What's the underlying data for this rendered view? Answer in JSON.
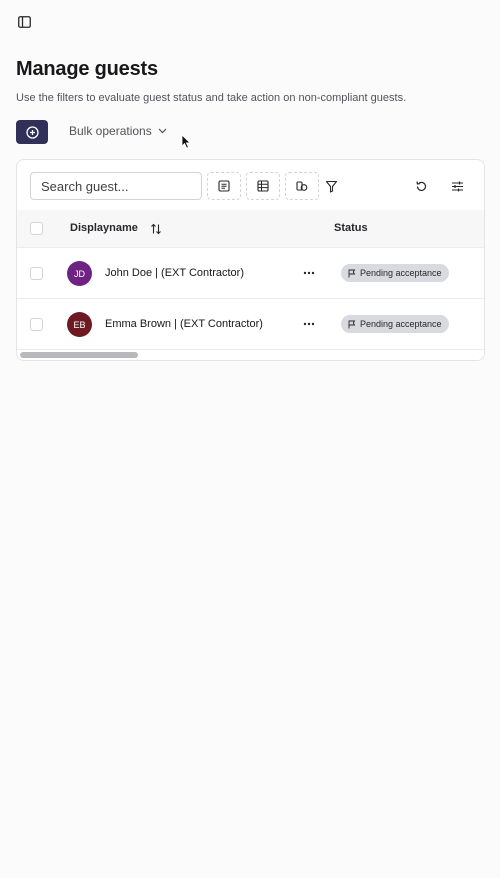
{
  "header": {
    "title": "Manage guests",
    "description": "Use the filters to evaluate guest status and take action on non-compliant guests."
  },
  "toolbar": {
    "bulk_label": "Bulk operations",
    "add_icon": "plus-circle-icon"
  },
  "search": {
    "placeholder": "Search guest..."
  },
  "table": {
    "columns": [
      "Displayname",
      "Status"
    ],
    "rows": [
      {
        "initials": "JD",
        "name": "John Doe | (EXT Contractor)",
        "status": "Pending acceptance",
        "avatar_color": "#6d2381"
      },
      {
        "initials": "EB",
        "name": "Emma Brown | (EXT Contractor)",
        "status": "Pending acceptance",
        "avatar_color": "#6e1a22"
      }
    ]
  },
  "colors": {
    "primary": "#2f3159",
    "badge_bg": "#d9dadf"
  }
}
